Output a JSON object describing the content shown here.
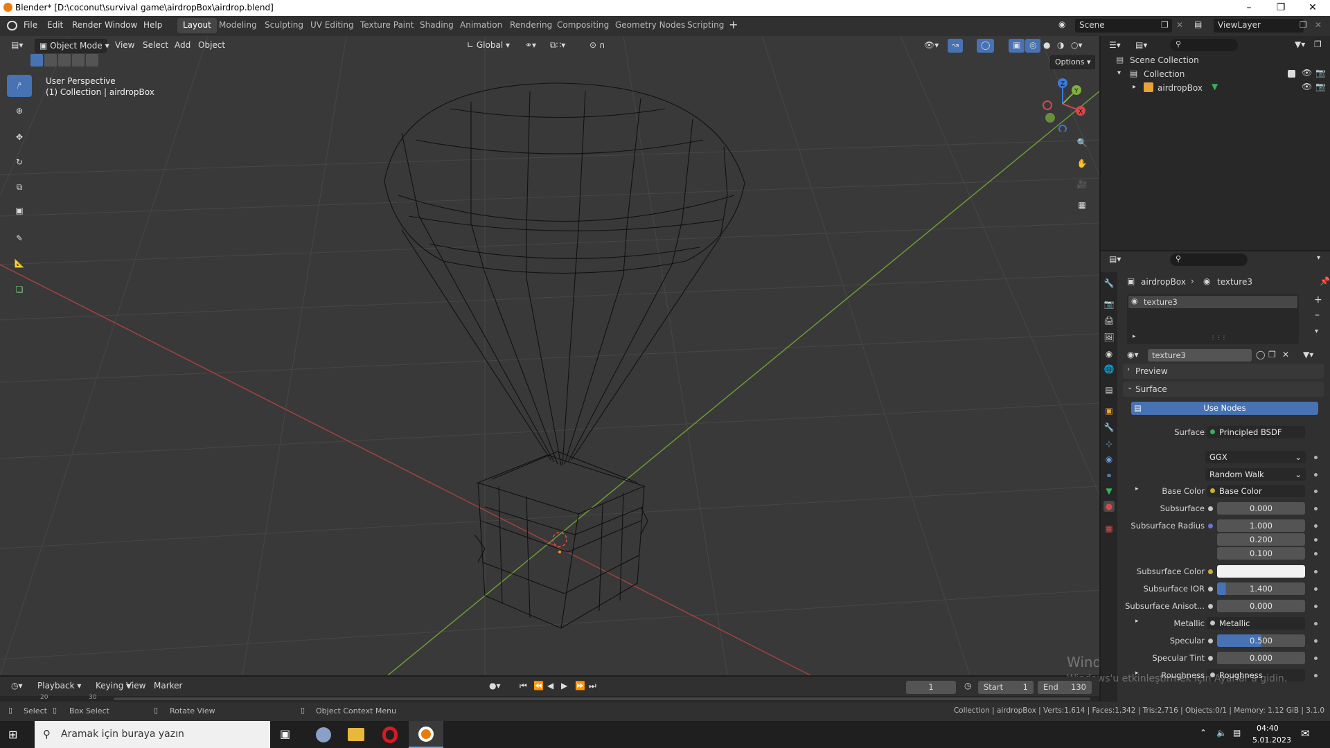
{
  "titlebar": {
    "title": "Blender* [D:\\coconut\\survival game\\airdropBox\\airdrop.blend]"
  },
  "menu": {
    "items": [
      "File",
      "Edit",
      "Render",
      "Window",
      "Help"
    ]
  },
  "workspaces": [
    "Layout",
    "Modeling",
    "Sculpting",
    "UV Editing",
    "Texture Paint",
    "Shading",
    "Animation",
    "Rendering",
    "Compositing",
    "Geometry Nodes",
    "Scripting"
  ],
  "workspace_active": "Layout",
  "scene": {
    "name": "Scene",
    "view_layer": "ViewLayer"
  },
  "viewport": {
    "mode": "Object Mode",
    "menus": [
      "View",
      "Select",
      "Add",
      "Object"
    ],
    "transform_orientation": "Global",
    "options_label": "Options",
    "info_line1": "User Perspective",
    "info_line2": "(1) Collection | airdropBox",
    "gizmo_axes": [
      "Z",
      "Y",
      "X"
    ]
  },
  "outliner": {
    "root": "Scene Collection",
    "collection": "Collection",
    "object": "airdropBox"
  },
  "properties": {
    "breadcrumb_object": "airdropBox",
    "breadcrumb_material": "texture3",
    "slot_name": "texture3",
    "material_name": "texture3",
    "panel_preview": "Preview",
    "panel_surface": "Surface",
    "use_nodes_label": "Use Nodes",
    "surface_label": "Surface",
    "surface_value": "Principled BSDF",
    "distribution": "GGX",
    "subsurface_method": "Random Walk",
    "rows": [
      {
        "label": "Base Color",
        "value": "Base Color"
      },
      {
        "label": "Subsurface",
        "value": "0.000"
      },
      {
        "label": "Subsurface Radius",
        "values": [
          "1.000",
          "0.200",
          "0.100"
        ]
      },
      {
        "label": "Subsurface Color",
        "value": ""
      },
      {
        "label": "Subsurface IOR",
        "value": "1.400"
      },
      {
        "label": "Subsurface Anisot...",
        "value": "0.000"
      },
      {
        "label": "Metallic",
        "value": "Metallic"
      },
      {
        "label": "Specular",
        "value": "0.500"
      },
      {
        "label": "Specular Tint",
        "value": "0.000"
      },
      {
        "label": "Roughness",
        "value": "Roughness"
      }
    ]
  },
  "timeline": {
    "menus": [
      "Playback",
      "Keying",
      "View",
      "Marker"
    ],
    "current_frame": "1",
    "start_label": "Start",
    "start_value": "1",
    "end_label": "End",
    "end_value": "130",
    "ruler": [
      "20",
      "30"
    ]
  },
  "statusbar": {
    "select": "Select",
    "box_select": "Box Select",
    "rotate_view": "Rotate View",
    "context_menu": "Object Context Menu",
    "stats": "Collection | airdropBox | Verts:1,614 | Faces:1,342 | Tris:2,716 | Objects:0/1 | Memory: 1.12 GiB | 3.1.0"
  },
  "watermark": {
    "line1": "Windows'u Etkinleştir",
    "line2": "Windows'u etkinleştirmek için Ayarlar'a gidin."
  },
  "taskbar": {
    "search_placeholder": "Aramak için buraya yazın",
    "time": "04:40",
    "date": "5.01.2023"
  },
  "colors": {
    "accent": "#4772b3",
    "x_axis": "#d34a4a",
    "y_axis": "#7fb13c",
    "z_axis": "#3d7ad6",
    "socket_yellow": "#c7b13a",
    "socket_green": "#38b15a",
    "socket_blue": "#6a74d6"
  }
}
